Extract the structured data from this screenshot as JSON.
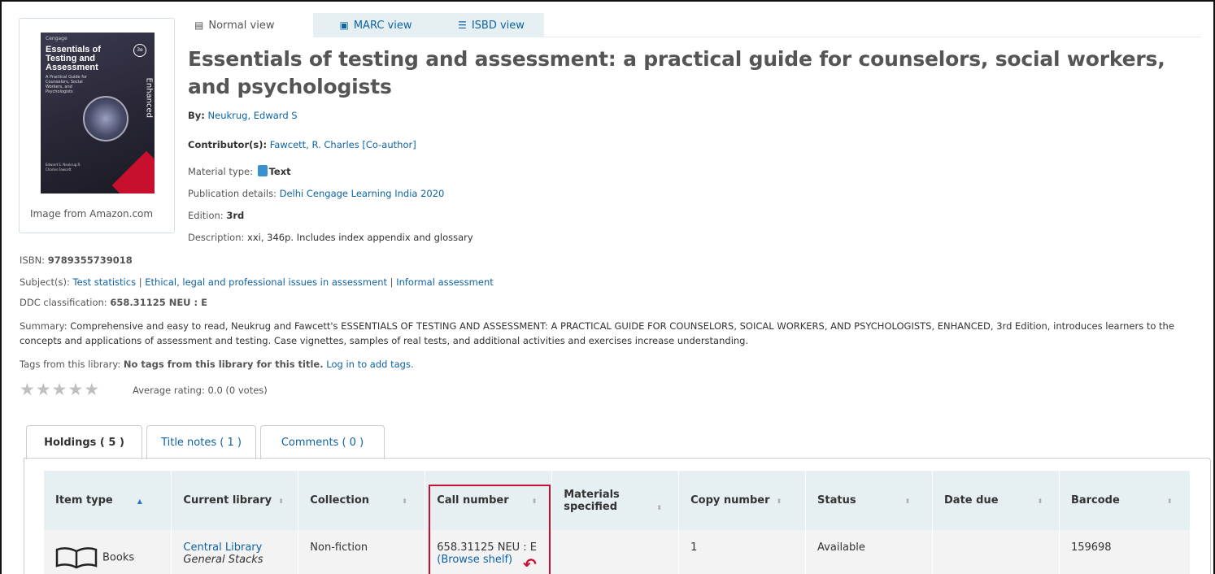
{
  "view_tabs": [
    {
      "label": "Normal view",
      "icon": "document-icon"
    },
    {
      "label": "MARC view",
      "icon": "marc-icon"
    },
    {
      "label": "ISBD view",
      "icon": "list-icon"
    }
  ],
  "cover": {
    "publisher": "Cengage",
    "title": "Essentials of Testing and Assessment",
    "subtitle": "A Practical Guide for Counselors, Social Workers, and Psychologists",
    "edition": "3e",
    "enhanced": "Enhanced",
    "authors": "Edward S. Neukrug R. Charles Fawcett",
    "caption": "Image from Amazon.com"
  },
  "record": {
    "title": "Essentials of testing and assessment: a practical guide for counselors, social workers, and psychologists",
    "by_label": "By:",
    "by_value": "Neukrug, Edward S",
    "contributors_label": "Contributor(s):",
    "contributors_value": "Fawcett, R. Charles [Co-author]",
    "material_label": "Material type:",
    "material_value": "Text",
    "publication_label": "Publication details:",
    "publication_value": "Delhi Cengage Learning India 2020",
    "edition_label": "Edition:",
    "edition_value": "3rd",
    "description_label": "Description:",
    "description_value": "xxi, 346p. Includes index appendix and glossary",
    "isbn_label": "ISBN:",
    "isbn_value": "9789355739018",
    "subjects_label": "Subject(s):",
    "subjects": [
      "Test statistics",
      "Ethical, legal and professional issues in assessment",
      "Informal assessment"
    ],
    "ddc_label": "DDC classification:",
    "ddc_value": "658.31125 NEU : E",
    "summary_label": "Summary:",
    "summary_value": "Comprehensive and easy to read, Neukrug and Fawcett's ESSENTIALS OF TESTING AND ASSESSMENT: A PRACTICAL GUIDE FOR COUNSELORS, SOICAL WORKERS, AND PSYCHOLOGISTS, ENHANCED, 3rd Edition, introduces learners to the concepts and applications of assessment and testing. Case vignettes, samples of real tests, and additional activities and exercises increase understanding.",
    "tags_label": "Tags from this library:",
    "tags_value": "No tags from this library for this title.",
    "tags_login": "Log in to add tags.",
    "rating_text": "Average rating: 0.0 (0 votes)",
    "stars": 0
  },
  "holdings_tabs": [
    {
      "label": "Holdings ( 5 )"
    },
    {
      "label": "Title notes ( 1 )"
    },
    {
      "label": "Comments ( 0 )"
    }
  ],
  "holdings_table": {
    "headers": [
      "Item type",
      "Current library",
      "Collection",
      "Call number",
      "Materials specified",
      "Copy number",
      "Status",
      "Date due",
      "Barcode"
    ],
    "rows": [
      {
        "item_type": "Books",
        "library": "Central Library",
        "location": "General Stacks",
        "collection": "Non-fiction",
        "call_number": "658.31125 NEU : E",
        "browse": "(Browse shelf)",
        "materials": "",
        "copy": "1",
        "status": "Available",
        "due": "",
        "barcode": "159698"
      }
    ]
  },
  "colors": {
    "link": "#0e63a4",
    "available": "#006100",
    "highlight": "#c8102e",
    "header_bg": "#e6f0f2"
  }
}
